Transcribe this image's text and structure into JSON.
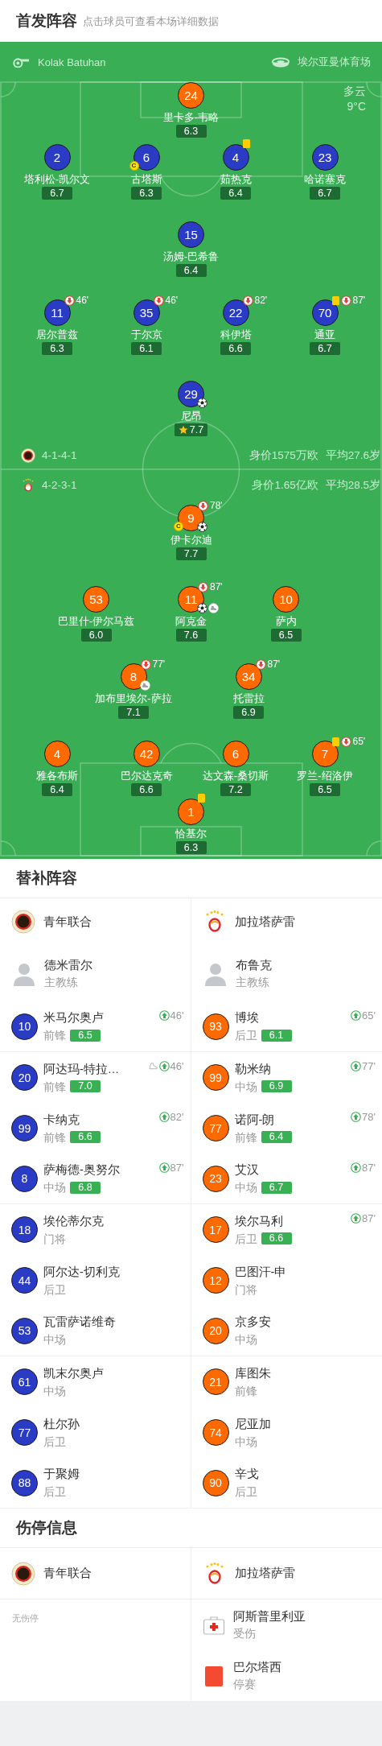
{
  "header": {
    "title": "首发阵容",
    "subtitle": "点击球员可查看本场详细数据"
  },
  "match_info": {
    "referee": "Kolak Batuhan",
    "stadium": "埃尔亚曼体育场",
    "weather": "多云",
    "temperature": "9°C"
  },
  "home": {
    "formation": "4-1-4-1",
    "market_value": "身价1575万欧",
    "average_age": "平均27.6岁",
    "rows": [
      [
        {
          "number": "24",
          "name": "里卡多-韦略",
          "rating": "6.3",
          "color": "#ff6a00",
          "mvp": false
        }
      ],
      [
        {
          "number": "2",
          "name": "塔利松-凯尔文",
          "rating": "6.7",
          "color": "#2a3cc6",
          "mvp": false
        },
        {
          "number": "6",
          "name": "古塔斯",
          "rating": "6.3",
          "color": "#2a3cc6",
          "captain_badge": "C",
          "mvp": false
        },
        {
          "number": "4",
          "name": "茹热克",
          "rating": "6.4",
          "color": "#2a3cc6",
          "mvp": false,
          "events": [
            {
              "kind": "yellow_card"
            }
          ]
        },
        {
          "number": "23",
          "name": "哈诺塞克",
          "rating": "6.7",
          "color": "#2a3cc6",
          "mvp": false
        }
      ],
      [
        {
          "number": "15",
          "name": "汤姆-巴希鲁",
          "rating": "6.4",
          "color": "#2a3cc6",
          "mvp": false
        }
      ],
      [
        {
          "number": "11",
          "name": "居尔普兹",
          "rating": "6.3",
          "color": "#2a3cc6",
          "mvp": false,
          "events": [
            {
              "kind": "sub_off",
              "minute": "46'"
            }
          ]
        },
        {
          "number": "35",
          "name": "于尔京",
          "rating": "6.1",
          "color": "#2a3cc6",
          "mvp": false,
          "events": [
            {
              "kind": "sub_off",
              "minute": "46'"
            }
          ]
        },
        {
          "number": "22",
          "name": "科伊塔",
          "rating": "6.6",
          "color": "#2a3cc6",
          "mvp": false,
          "events": [
            {
              "kind": "sub_off",
              "minute": "82'"
            }
          ]
        },
        {
          "number": "70",
          "name": "通亚",
          "rating": "6.7",
          "color": "#2a3cc6",
          "mvp": false,
          "events": [
            {
              "kind": "yellow_card"
            },
            {
              "kind": "sub_off",
              "minute": "87'"
            }
          ]
        }
      ],
      [
        {
          "number": "29",
          "name": "尼昂",
          "rating": "7.7",
          "color": "#2a3cc6",
          "mvp": true,
          "events": [
            {
              "kind": "goal"
            }
          ]
        }
      ]
    ]
  },
  "away": {
    "formation": "4-2-3-1",
    "market_value": "身价1.65亿欧",
    "average_age": "平均28.5岁",
    "rows": [
      [
        {
          "number": "9",
          "name": "伊卡尔迪",
          "rating": "7.7",
          "color": "#ff6a00",
          "captain_badge": "C",
          "mvp": false,
          "events": [
            {
              "kind": "sub_off",
              "minute": "78'"
            },
            {
              "kind": "goal"
            }
          ]
        }
      ],
      [
        {
          "number": "53",
          "name": "巴里什-伊尔马兹",
          "rating": "6.0",
          "color": "#ff6a00",
          "mvp": false
        },
        {
          "number": "11",
          "name": "阿克金",
          "rating": "7.6",
          "color": "#ff6a00",
          "mvp": false,
          "events": [
            {
              "kind": "sub_off",
              "minute": "87'"
            },
            {
              "kind": "goal"
            },
            {
              "kind": "assist"
            }
          ]
        },
        {
          "number": "10",
          "name": "萨内",
          "rating": "6.5",
          "color": "#ff6a00",
          "mvp": false
        }
      ],
      [
        {
          "number": "8",
          "name": "加布里埃尔-萨拉",
          "rating": "7.1",
          "color": "#ff6a00",
          "mvp": false,
          "events": [
            {
              "kind": "sub_off",
              "minute": "77'"
            },
            {
              "kind": "assist"
            }
          ]
        },
        {
          "number": "34",
          "name": "托雷拉",
          "rating": "6.9",
          "color": "#ff6a00",
          "mvp": false,
          "events": [
            {
              "kind": "sub_off",
              "minute": "87'"
            }
          ]
        }
      ],
      [
        {
          "number": "4",
          "name": "雅各布斯",
          "rating": "6.4",
          "color": "#ff6a00",
          "mvp": false
        },
        {
          "number": "42",
          "name": "巴尔达克奇",
          "rating": "6.6",
          "color": "#ff6a00",
          "mvp": false
        },
        {
          "number": "6",
          "name": "达文森-桑切斯",
          "rating": "7.2",
          "color": "#ff6a00",
          "mvp": false
        },
        {
          "number": "7",
          "name": "罗兰-绍洛伊",
          "rating": "6.5",
          "color": "#ff6a00",
          "mvp": false,
          "events": [
            {
              "kind": "yellow_card"
            },
            {
              "kind": "sub_off",
              "minute": "65'"
            }
          ]
        }
      ],
      [
        {
          "number": "1",
          "name": "恰基尔",
          "rating": "6.3",
          "color": "#ff6a00",
          "mvp": false,
          "events": [
            {
              "kind": "yellow_card"
            }
          ]
        }
      ]
    ]
  },
  "substitutes": {
    "title": "替补阵容",
    "teams": [
      {
        "name": "青年联合",
        "coach": {
          "name": "德米雷尔",
          "role": "主教练"
        },
        "players": [
          {
            "number": "10",
            "name": "米马尔奥卢",
            "position": "前锋",
            "rating": "6.5",
            "color": "#2a3cc6",
            "events": [
              {
                "kind": "sub_on",
                "minute": "46'"
              }
            ]
          },
          {
            "number": "20",
            "name": "阿达玛-特拉…",
            "position": "前锋",
            "rating": "7.0",
            "color": "#2a3cc6",
            "events": [
              {
                "kind": "assist"
              },
              {
                "kind": "sub_on",
                "minute": "46'"
              }
            ]
          },
          {
            "number": "99",
            "name": "卡纳克",
            "position": "前锋",
            "rating": "6.6",
            "color": "#2a3cc6",
            "events": [
              {
                "kind": "sub_on",
                "minute": "82'"
              }
            ]
          },
          {
            "number": "8",
            "name": "萨梅德-奥努尔",
            "position": "中场",
            "rating": "6.8",
            "color": "#2a3cc6",
            "events": [
              {
                "kind": "sub_on",
                "minute": "87'"
              }
            ]
          },
          {
            "number": "18",
            "name": "埃伦蒂尔克",
            "position": "门将",
            "color": "#2a3cc6"
          },
          {
            "number": "44",
            "name": "阿尔达-切利克",
            "position": "后卫",
            "color": "#2a3cc6"
          },
          {
            "number": "53",
            "name": "瓦雷萨诺维奇",
            "position": "中场",
            "color": "#2a3cc6"
          },
          {
            "number": "61",
            "name": "凯末尔奥卢",
            "position": "中场",
            "color": "#2a3cc6"
          },
          {
            "number": "77",
            "name": "杜尔孙",
            "position": "后卫",
            "color": "#2a3cc6"
          },
          {
            "number": "88",
            "name": "于聚姆",
            "position": "后卫",
            "color": "#2a3cc6"
          }
        ]
      },
      {
        "name": "加拉塔萨雷",
        "coach": {
          "name": "布鲁克",
          "role": "主教练"
        },
        "players": [
          {
            "number": "93",
            "name": "博埃",
            "position": "后卫",
            "rating": "6.1",
            "color": "#ff6a00",
            "events": [
              {
                "kind": "sub_on",
                "minute": "65'"
              }
            ]
          },
          {
            "number": "99",
            "name": "勒米纳",
            "position": "中场",
            "rating": "6.9",
            "color": "#ff6a00",
            "events": [
              {
                "kind": "sub_on",
                "minute": "77'"
              }
            ]
          },
          {
            "number": "77",
            "name": "诺阿-朗",
            "position": "前锋",
            "rating": "6.4",
            "color": "#ff6a00",
            "events": [
              {
                "kind": "sub_on",
                "minute": "78'"
              }
            ]
          },
          {
            "number": "23",
            "name": "艾汉",
            "position": "中场",
            "rating": "6.7",
            "color": "#ff6a00",
            "events": [
              {
                "kind": "sub_on",
                "minute": "87'"
              }
            ]
          },
          {
            "number": "17",
            "name": "埃尔马利",
            "position": "后卫",
            "rating": "6.6",
            "color": "#ff6a00",
            "events": [
              {
                "kind": "sub_on",
                "minute": "87'"
              }
            ]
          },
          {
            "number": "12",
            "name": "巴图汗-申",
            "position": "门将",
            "color": "#ff6a00"
          },
          {
            "number": "20",
            "name": "京多安",
            "position": "中场",
            "color": "#ff6a00"
          },
          {
            "number": "21",
            "name": "库图朱",
            "position": "前锋",
            "color": "#ff6a00"
          },
          {
            "number": "74",
            "name": "尼亚加",
            "position": "中场",
            "color": "#ff6a00"
          },
          {
            "number": "90",
            "name": "辛戈",
            "position": "后卫",
            "color": "#ff6a00"
          }
        ]
      }
    ]
  },
  "injuries": {
    "title": "伤停信息",
    "teams": [
      {
        "name": "青年联合",
        "empty_text": "无伤停"
      },
      {
        "name": "加拉塔萨雷",
        "players": [
          {
            "name": "阿斯普里利亚",
            "status": "受伤",
            "kind": "injury"
          },
          {
            "name": "巴尔塔西",
            "status": "停赛",
            "kind": "suspension"
          }
        ]
      }
    ]
  }
}
